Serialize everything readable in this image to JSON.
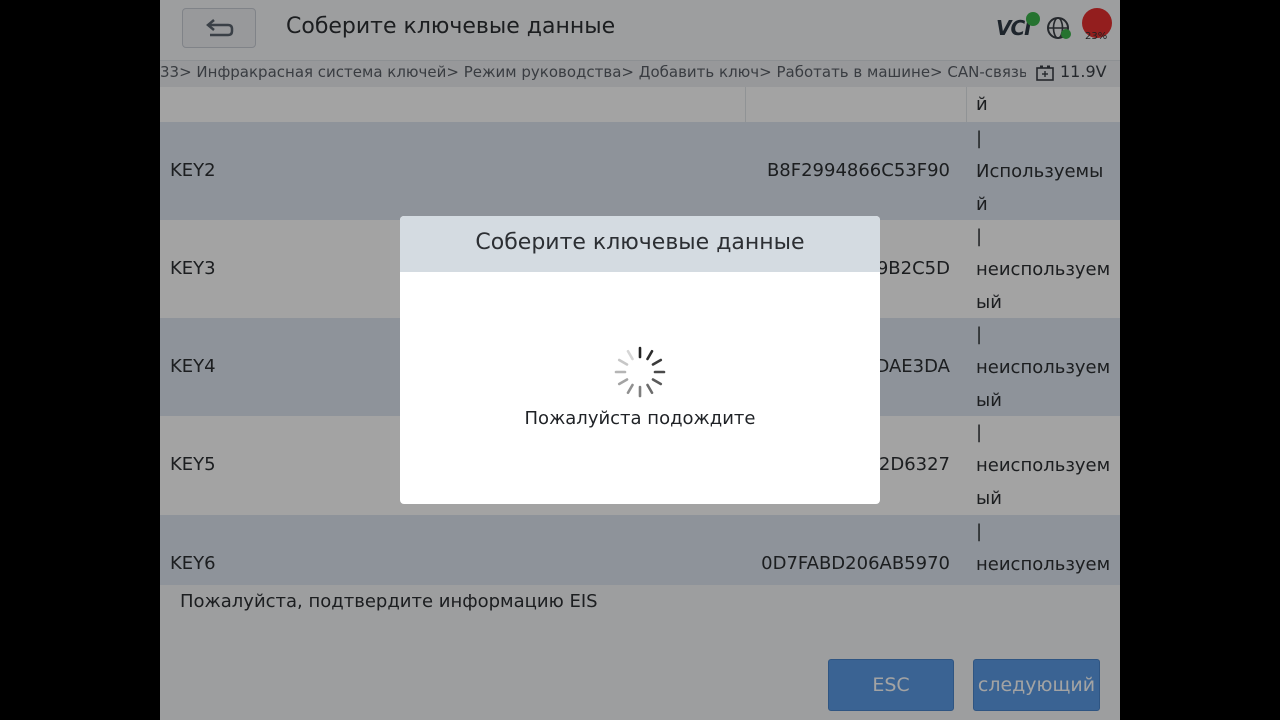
{
  "header": {
    "title": "Соберите ключевые данные",
    "vci_label": "VCI",
    "battery_pct": "23%"
  },
  "breadcrumb": {
    "text": "33> Инфракрасная система ключей> Режим руководства> Добавить ключ> Работать в машине> CAN-связь (OBD)",
    "voltage": "11.9V"
  },
  "table": {
    "rows": [
      {
        "name": "",
        "id": "",
        "status": "й"
      },
      {
        "name": "KEY2",
        "id": "B8F2994866C53F90",
        "status": "|\nИспользуемы\nй"
      },
      {
        "name": "KEY3",
        "id": "9B2C5D",
        "status": "|\nнеиспользуем\nый"
      },
      {
        "name": "KEY4",
        "id": "DAE3DA",
        "status": "|\nнеиспользуем\nый"
      },
      {
        "name": "KEY5",
        "id": "2D6327",
        "status": "|\nнеиспользуем\nый"
      },
      {
        "name": "KEY6",
        "id": "0D7FABD206AB5970",
        "status": "|\nнеиспользуем"
      }
    ]
  },
  "footer": {
    "confirm_text": "Пожалуйста, подтвердите информацию EIS",
    "esc_label": "ESC",
    "next_label": "следующий"
  },
  "dialog": {
    "title": "Соберите ключевые данные",
    "message": "Пожалуйста подождите"
  },
  "colors": {
    "accent": "#5b9ce6",
    "row_alt": "#dfe7f1",
    "battery": "#e63030",
    "ok": "#3cb44b"
  }
}
